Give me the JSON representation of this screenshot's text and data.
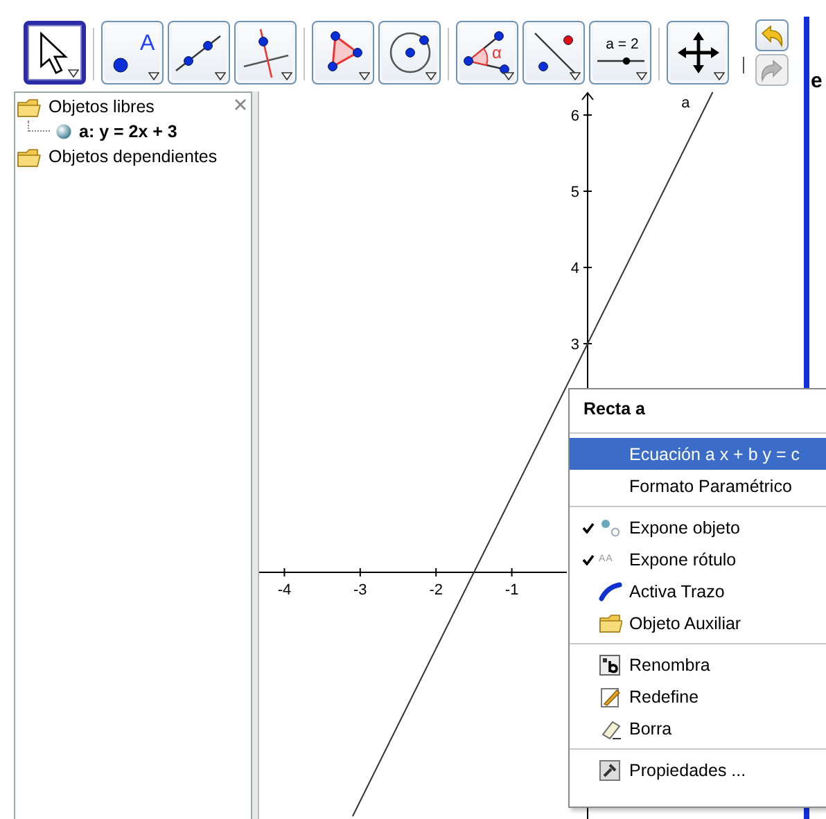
{
  "toolbar": {
    "tools": [
      {
        "selected": true
      },
      {
        "selected": false,
        "label": "A"
      },
      {
        "selected": false
      },
      {
        "selected": false
      },
      {
        "selected": false
      },
      {
        "selected": false
      },
      {
        "selected": false,
        "label": "α"
      },
      {
        "selected": false
      },
      {
        "selected": false,
        "label": "a = 2"
      },
      {
        "selected": false
      }
    ],
    "history": [
      {
        "disabled": false
      },
      {
        "disabled": true
      }
    ]
  },
  "algebra_view": {
    "items": [
      {
        "label": "Objetos libres",
        "children": [
          {
            "label": "a: y = 2x + 3"
          }
        ]
      },
      {
        "label": "Objetos dependientes"
      }
    ]
  },
  "graphics_view": {
    "chart_data": {
      "type": "line",
      "x": [
        -3.1,
        1.65
      ],
      "series": [
        {
          "name": "a",
          "color": "#333333",
          "values": [
            -3.2,
            6.3
          ]
        }
      ],
      "xlim": [
        -4.333,
        2.834
      ],
      "ylim": [
        -3.236,
        6.309
      ],
      "xticks": [
        -4,
        -3,
        -2,
        -1
      ],
      "yticks": [
        3,
        4,
        5,
        6
      ]
    }
  },
  "context_menu": {
    "title": "Recta a",
    "groups": [
      [
        {
          "label": "Ecuación a x + b y = c",
          "selected": true,
          "checked": false
        },
        {
          "label": "Formato Paramétrico",
          "selected": false,
          "checked": false
        }
      ],
      [
        {
          "label": "Expone objeto",
          "selected": false,
          "checked": true
        },
        {
          "label": "Expone rótulo",
          "selected": false,
          "checked": true,
          "icon_label": "AA"
        },
        {
          "label": "Activa Trazo",
          "selected": false,
          "checked": false
        },
        {
          "label": "Objeto Auxiliar",
          "selected": false,
          "checked": false
        }
      ],
      [
        {
          "label": "Renombra",
          "selected": false,
          "checked": false
        },
        {
          "label": "Redefine",
          "selected": false,
          "checked": false
        },
        {
          "label": "Borra",
          "selected": false,
          "checked": false
        }
      ],
      [
        {
          "label": "Propiedades ...",
          "selected": false,
          "checked": false
        }
      ]
    ]
  },
  "side_text": "e"
}
